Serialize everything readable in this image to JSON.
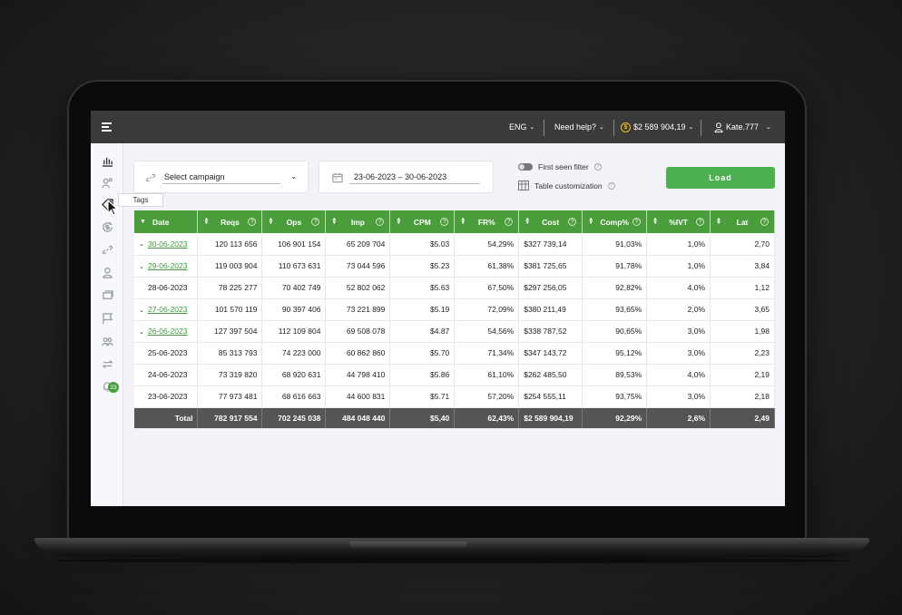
{
  "topbar": {
    "language": "ENG",
    "help": "Need help?",
    "balance": "$2 589 904,19",
    "user": "Kate.777"
  },
  "sidebar": {
    "tooltip": "Tags",
    "badge": "23",
    "icons": [
      "bar-chart-icon",
      "users-group-icon",
      "tag-icon",
      "refresh-dollar-icon",
      "link-icon",
      "user-icon",
      "layers-icon",
      "flag-icon",
      "users-icon",
      "swap-icon",
      "bell-icon"
    ]
  },
  "controls": {
    "campaign_placeholder": "Select campaign",
    "date_range": "23-06-2023  –  30-06-2023",
    "first_seen_filter": "First seen filter",
    "table_customization": "Table customization",
    "load": "Load"
  },
  "table": {
    "headers": [
      "Date",
      "Reqs",
      "Ops",
      "Imp",
      "CPM",
      "FR%",
      "Cost",
      "Comp%",
      "%IVT",
      "Lat"
    ],
    "rows": [
      {
        "date": "30-06-2023",
        "expandable": true,
        "reqs": "120 113 656",
        "ops": "106 901 154",
        "imp": "65 209 704",
        "cpm": "$5.03",
        "fr": "54,29%",
        "cost": "$327 739,14",
        "comp": "91,03%",
        "ivt": "1,0%",
        "lat": "2,70"
      },
      {
        "date": "29-06-2023",
        "expandable": true,
        "reqs": "119 003 904",
        "ops": "110 673 631",
        "imp": "73 044 596",
        "cpm": "$5.23",
        "fr": "61,38%",
        "cost": "$381 725,65",
        "comp": "91,78%",
        "ivt": "1,0%",
        "lat": "3,84"
      },
      {
        "date": "28-06-2023",
        "expandable": false,
        "reqs": "78 225 277",
        "ops": "70 402 749",
        "imp": "52 802 062",
        "cpm": "$5.63",
        "fr": "67,50%",
        "cost": "$297 256,05",
        "comp": "92,82%",
        "ivt": "4,0%",
        "lat": "1,12"
      },
      {
        "date": "27-06-2023",
        "expandable": true,
        "reqs": "101 570 119",
        "ops": "90 397 406",
        "imp": "73 221 899",
        "cpm": "$5.19",
        "fr": "72,09%",
        "cost": "$380 211,49",
        "comp": "93,65%",
        "ivt": "2,0%",
        "lat": "3,65"
      },
      {
        "date": "26-06-2023",
        "expandable": true,
        "reqs": "127 397 504",
        "ops": "112 109 804",
        "imp": "69 508 078",
        "cpm": "$4.87",
        "fr": "54,56%",
        "cost": "$338 787,52",
        "comp": "90,65%",
        "ivt": "3,0%",
        "lat": "1,98"
      },
      {
        "date": "25-06-2023",
        "expandable": false,
        "reqs": "85 313 793",
        "ops": "74 223 000",
        "imp": "60 862 860",
        "cpm": "$5.70",
        "fr": "71,34%",
        "cost": "$347 143,72",
        "comp": "95,12%",
        "ivt": "3,0%",
        "lat": "2,23"
      },
      {
        "date": "24-06-2023",
        "expandable": false,
        "reqs": "73 319 820",
        "ops": "68 920 631",
        "imp": "44 798 410",
        "cpm": "$5.86",
        "fr": "61,10%",
        "cost": "$262 485,50",
        "comp": "89,53%",
        "ivt": "4,0%",
        "lat": "2,19"
      },
      {
        "date": "23-06-2023",
        "expandable": false,
        "reqs": "77 973 481",
        "ops": "68 616 663",
        "imp": "44 600 831",
        "cpm": "$5.71",
        "fr": "57,20%",
        "cost": "$254 555,11",
        "comp": "93,75%",
        "ivt": "3,0%",
        "lat": "2,18"
      }
    ],
    "total": {
      "label": "Total",
      "reqs": "782 917 554",
      "ops": "702 245 038",
      "imp": "484 048 440",
      "cpm": "$5,40",
      "fr": "62,43%",
      "cost": "$2 589 904,19",
      "comp": "92,29%",
      "ivt": "2,6%",
      "lat": "2,49"
    }
  },
  "colors": {
    "accent": "#4a9d3b",
    "load_button": "#4caf50",
    "topbar": "#3b3b3b",
    "total_row": "#555555",
    "balance_coin": "#f3c11b"
  }
}
